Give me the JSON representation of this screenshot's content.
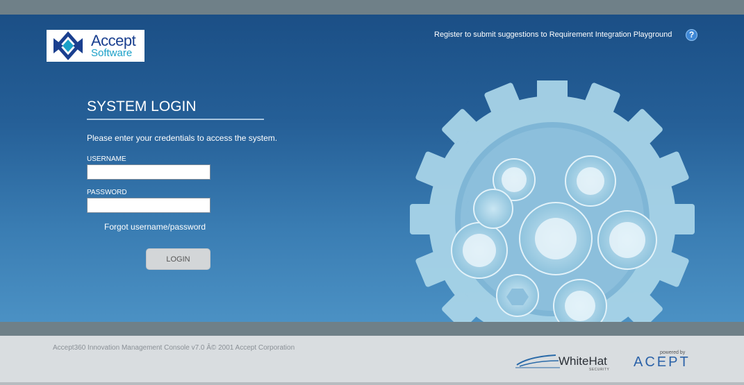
{
  "logo": {
    "line1": "Accept",
    "line2": "Software"
  },
  "header": {
    "register_text": "Register to submit suggestions to Requirement Integration Playground",
    "help_label": "?"
  },
  "login": {
    "title": "SYSTEM LOGIN",
    "intro": "Please enter your credentials to access the system.",
    "username_label": "USERNAME",
    "username_value": "",
    "password_label": "PASSWORD",
    "password_value": "",
    "forgot_text": "Forgot username/password",
    "button_label": "LOGIN"
  },
  "footer": {
    "copyright": "Accept360 Innovation Management Console v7.0 Â© 2001 Accept Corporation",
    "whitehat_text": "WhiteHat",
    "whitehat_sub": "SECURITY",
    "powered_by": "powered by",
    "accept_logo_text": "ACEPT"
  },
  "colors": {
    "hero_top": "#1b4f86",
    "hero_bottom": "#4b91c4",
    "bar": "#6f8088",
    "footer_bg": "#d9dde0",
    "gear": "#a8d4e8"
  },
  "icons": [
    "accept-logo-icon",
    "help-icon",
    "gear-illustration",
    "whitehat-logo-icon"
  ]
}
